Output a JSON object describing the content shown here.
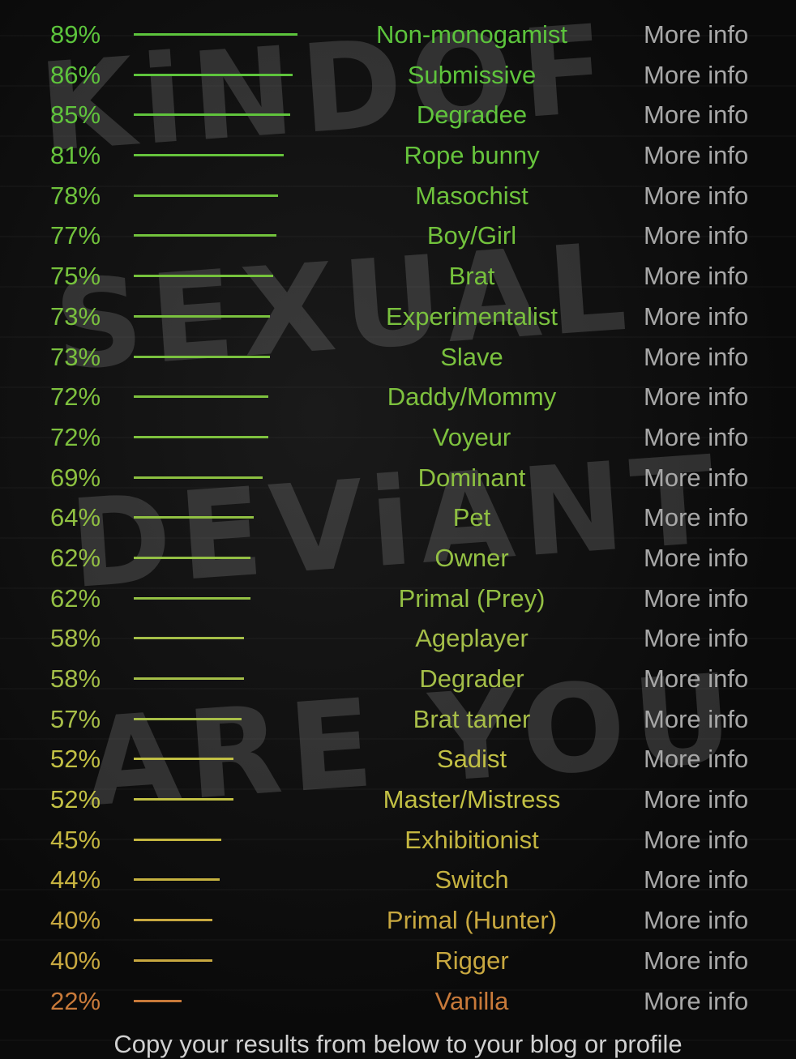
{
  "background_lettering": "KiND OF SEXUAL DEViANT ARE YOU",
  "more_info_label": "More info",
  "results": [
    {
      "percent": 89,
      "label": "89%",
      "name": "Non-monogamist",
      "color": "#5cc43c"
    },
    {
      "percent": 86,
      "label": "86%",
      "name": "Submissive",
      "color": "#5ec43c"
    },
    {
      "percent": 85,
      "label": "85%",
      "name": "Degradee",
      "color": "#60c43c"
    },
    {
      "percent": 81,
      "label": "81%",
      "name": "Rope bunny",
      "color": "#66c33c"
    },
    {
      "percent": 78,
      "label": "78%",
      "name": "Masochist",
      "color": "#6ec23c"
    },
    {
      "percent": 77,
      "label": "77%",
      "name": "Boy/Girl",
      "color": "#72c23c"
    },
    {
      "percent": 75,
      "label": "75%",
      "name": "Brat",
      "color": "#76c23c"
    },
    {
      "percent": 73,
      "label": "73%",
      "name": "Experimentalist",
      "color": "#7ac13e"
    },
    {
      "percent": 73,
      "label": "73%",
      "name": "Slave",
      "color": "#7ac13e"
    },
    {
      "percent": 72,
      "label": "72%",
      "name": "Daddy/Mommy",
      "color": "#7ec13e"
    },
    {
      "percent": 72,
      "label": "72%",
      "name": "Voyeur",
      "color": "#7ec13e"
    },
    {
      "percent": 69,
      "label": "69%",
      "name": "Dominant",
      "color": "#8cc040"
    },
    {
      "percent": 64,
      "label": "64%",
      "name": "Pet",
      "color": "#90c042"
    },
    {
      "percent": 62,
      "label": "62%",
      "name": "Owner",
      "color": "#94c044"
    },
    {
      "percent": 62,
      "label": "62%",
      "name": "Primal (Prey)",
      "color": "#94c044"
    },
    {
      "percent": 58,
      "label": "58%",
      "name": "Ageplayer",
      "color": "#a4be48"
    },
    {
      "percent": 58,
      "label": "58%",
      "name": "Degrader",
      "color": "#a4be48"
    },
    {
      "percent": 57,
      "label": "57%",
      "name": "Brat tamer",
      "color": "#a8be48"
    },
    {
      "percent": 52,
      "label": "52%",
      "name": "Sadist",
      "color": "#c2c044"
    },
    {
      "percent": 52,
      "label": "52%",
      "name": "Master/Mistress",
      "color": "#c2c044"
    },
    {
      "percent": 45,
      "label": "45%",
      "name": "Exhibitionist",
      "color": "#c4b640"
    },
    {
      "percent": 44,
      "label": "44%",
      "name": "Switch",
      "color": "#c6b240"
    },
    {
      "percent": 40,
      "label": "40%",
      "name": "Primal (Hunter)",
      "color": "#c8a840"
    },
    {
      "percent": 40,
      "label": "40%",
      "name": "Rigger",
      "color": "#c8a840"
    },
    {
      "percent": 22,
      "label": "22%",
      "name": "Vanilla",
      "color": "#c87a3a"
    }
  ],
  "footer_text": "Copy your results from below to your blog or profile"
}
